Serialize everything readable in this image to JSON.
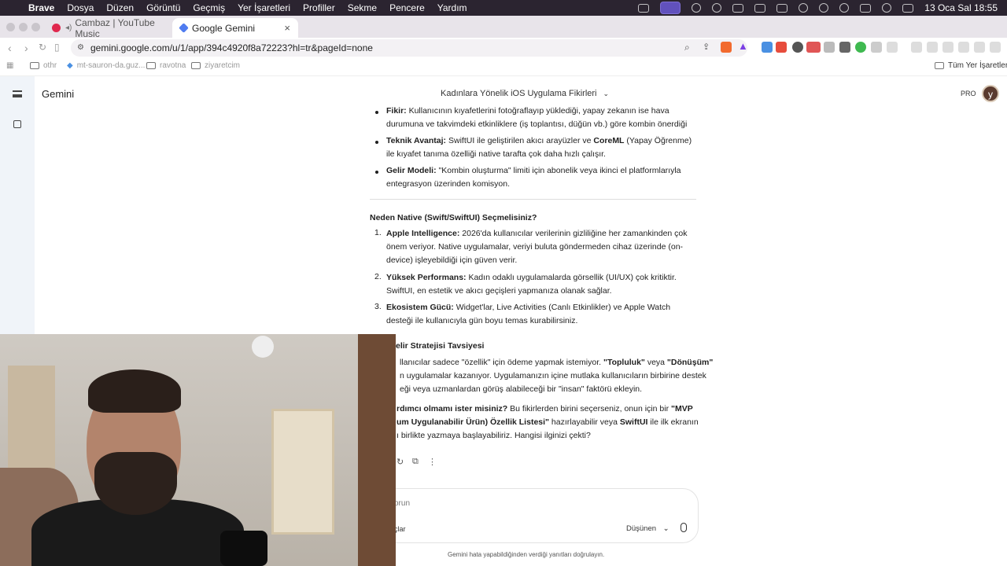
{
  "menubar": {
    "app": "Brave",
    "items": [
      "Dosya",
      "Düzen",
      "Görüntü",
      "Geçmiş",
      "Yer İşaretleri",
      "Profiller",
      "Sekme",
      "Pencere",
      "Yardım"
    ],
    "clock": "13 Oca Sal  18:55"
  },
  "tabs": [
    {
      "title": "Cambaz | YouTube Music",
      "favicon_color": "#e0284e"
    },
    {
      "title": "Google Gemini",
      "favicon_color": "#4f7cf0"
    }
  ],
  "address": {
    "url": "gemini.google.com/u/1/app/394c4920f8a72223?hl=tr&pageId=none"
  },
  "bookmarks": {
    "items": [
      "othr",
      "mt-sauron-da.guz...",
      "ravotna",
      "ziyaretcim"
    ],
    "all_bookmarks": "Tüm Yer İşaretleri"
  },
  "gemini": {
    "brand": "Gemini",
    "conversation_title": "Kadınlara Yönelik iOS Uygulama Fikirleri",
    "plan_badge": "PRO",
    "avatar_letter": "y",
    "top_bullets": [
      {
        "bold": "Fikir:",
        "text": " Kullanıcının kıyafetlerini fotoğraflayıp yüklediği, yapay zekanın ise hava durumuna ve takvimdeki etkinliklere (iş toplantısı, düğün vb.) göre kombin önerdiği bir dijital gardırop."
      },
      {
        "bold": "Teknik Avantaj:",
        "text": " SwiftUI ile geliştirilen akıcı arayüzler ve ",
        "bold2": "CoreML",
        "text2": " (Yapay Öğrenme) ile kıyafet tanıma özelliği native tarafta çok daha hızlı çalışır."
      },
      {
        "bold": "Gelir Modeli:",
        "text": " \"Kombin oluşturma\" limiti için abonelik veya ikinci el platformlarıyla entegrasyon üzerinden komisyon."
      }
    ],
    "native_heading": "Neden Native (Swift/SwiftUI) Seçmelisiniz?",
    "native_items": [
      {
        "n": "1.",
        "bold": "Apple Intelligence:",
        "text": " 2026'da kullanıcılar verilerinin gizliliğine her zamankinden çok önem veriyor. Native uygulamalar, veriyi buluta göndermeden cihaz üzerinde (on-device) işleyebildiği için güven verir."
      },
      {
        "n": "2.",
        "bold": "Yüksek Performans:",
        "text": " Kadın odaklı uygulamalarda görsellik (UI/UX) çok kritiktir. SwiftUI, en estetik ve akıcı geçişleri yapmanıza olanak sağlar."
      },
      {
        "n": "3.",
        "bold": "Ekosistem Gücü:",
        "text": " Widget'lar, Live Activities (Canlı Etkinlikler) ve Apple Watch desteği ile kullanıcıyla gün boyu temas kurabilirsiniz."
      }
    ],
    "strategy_heading": "elir Stratejisi Tavsiyesi",
    "strategy_lines": [
      "llanıcılar sadece \"özellik\" için ödeme yapmak istemiyor. ",
      "n uygulamalar kazanıyor. Uygulamanızın içine mutlaka kullanıcıların birbirine destek",
      "eği veya uzmanlardan görüş alabileceği bir \"insan\" faktörü ekleyin."
    ],
    "strategy_bold_1": "\"Topluluk\"",
    "strategy_mid": " veya ",
    "strategy_bold_2": "\"Dönüşüm\"",
    "help_bold": "rdımcı olmamı ister misiniz?",
    "help_text": " Bu fikirlerden birini seçerseniz, onun için bir ",
    "help_bold_2": "\"MVP",
    "help_line2_bold": "um Uygulanabilir Ürün) Özellik Listesi\"",
    "help_line2_text": " hazırlayabilir veya ",
    "help_line2_bold2": "SwiftUI",
    "help_line2_text2": " ile ilk ekranın",
    "help_line3": "ı birlikte yazmaya başlayabiliriz. Hangisi ilginizi çekti?",
    "input_placeholder": "orun",
    "tools_label": "çlar",
    "mode_label": "Düşünen",
    "disclaimer": "Gemini hata yapabildiğinden verdiği yanıtları doğrulayın."
  }
}
